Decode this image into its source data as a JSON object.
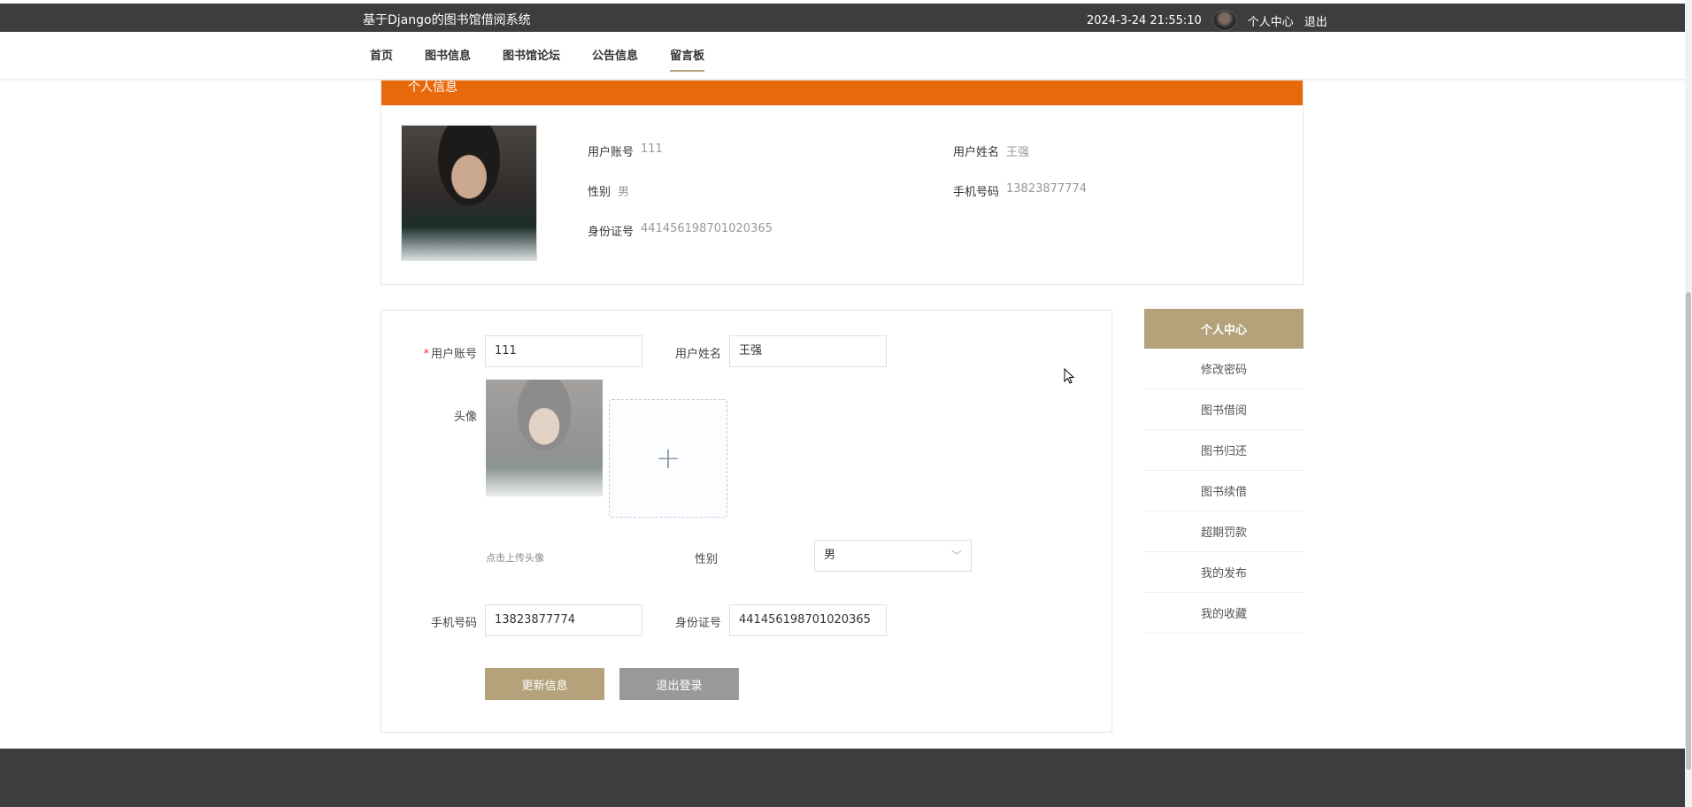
{
  "header": {
    "site_title": "基于Django的图书馆借阅系统",
    "datetime": "2024-3-24 21:55:10",
    "user_center": "个人中心",
    "logout": "退出"
  },
  "nav": {
    "items": [
      {
        "label": "首页",
        "active": false
      },
      {
        "label": "图书信息",
        "active": false
      },
      {
        "label": "图书馆论坛",
        "active": false
      },
      {
        "label": "公告信息",
        "active": false
      },
      {
        "label": "留言板",
        "active": true
      }
    ]
  },
  "profile": {
    "header": "个人信息",
    "fields": [
      {
        "label": "用户账号",
        "value": "111"
      },
      {
        "label": "用户姓名",
        "value": "王强"
      },
      {
        "label": "性别",
        "value": "男"
      },
      {
        "label": "手机号码",
        "value": "13823877774"
      },
      {
        "label": "身份证号",
        "value": "441456198701020365"
      }
    ]
  },
  "form": {
    "account_label": "用户账号",
    "account_value": "111",
    "name_label": "用户姓名",
    "name_value": "王强",
    "avatar_label": "头像",
    "upload_plus": "+",
    "upload_hint": "点击上传头像",
    "gender_label": "性别",
    "gender_value": "男",
    "phone_label": "手机号码",
    "phone_value": "13823877774",
    "idcard_label": "身份证号",
    "idcard_value": "441456198701020365",
    "update_button": "更新信息",
    "logout_button": "退出登录"
  },
  "side_menu": {
    "title": "个人中心",
    "items": [
      "修改密码",
      "图书借阅",
      "图书归还",
      "图书续借",
      "超期罚款",
      "我的发布",
      "我的收藏"
    ]
  },
  "colors": {
    "accent": "#b5a27a",
    "profile_header": "#e8690a",
    "topbar": "#3d3d3d"
  }
}
